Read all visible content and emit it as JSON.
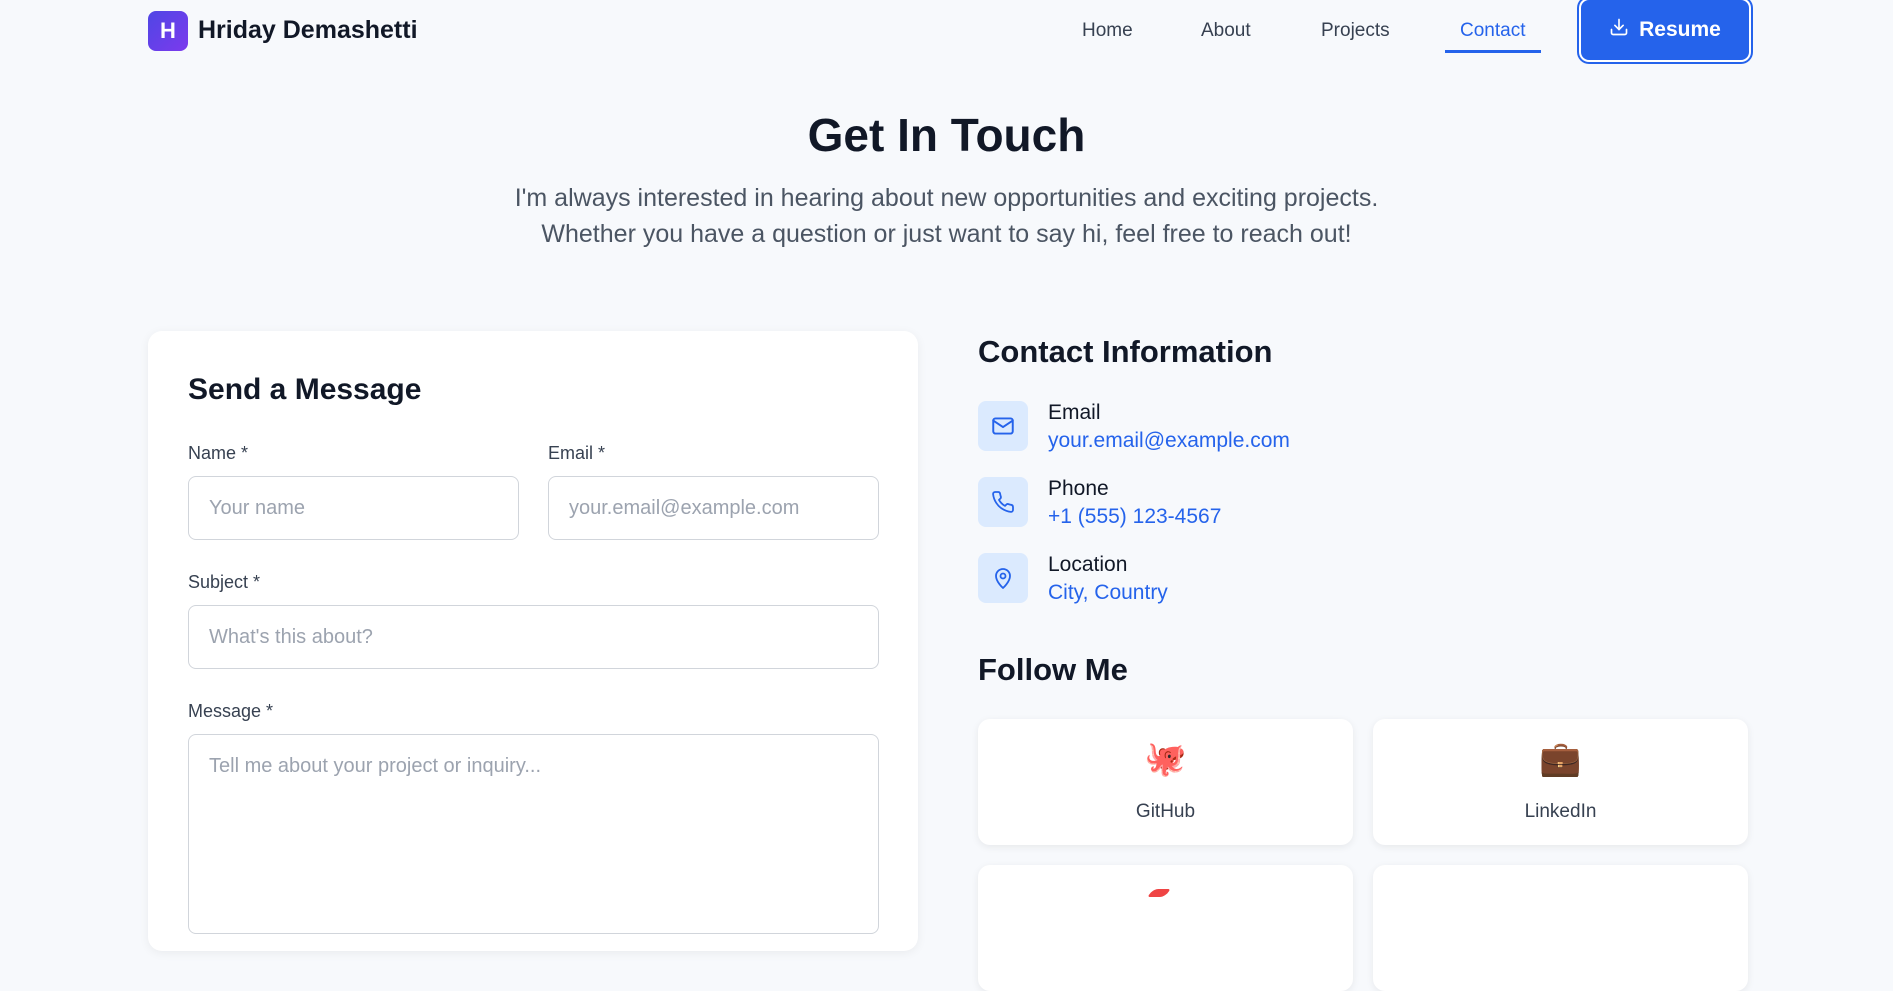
{
  "header": {
    "logo_letter": "H",
    "brand": "Hriday Demashetti",
    "nav": {
      "home": "Home",
      "about": "About",
      "projects": "Projects",
      "contact": "Contact"
    },
    "active_nav": "Contact",
    "resume_label": "Resume"
  },
  "hero": {
    "title": "Get In Touch",
    "subtitle_line1": "I'm always interested in hearing about new opportunities and exciting projects.",
    "subtitle_line2": "Whether you have a question or just want to say hi, feel free to reach out!"
  },
  "form": {
    "title": "Send a Message",
    "name_label": "Name *",
    "name_placeholder": "Your name",
    "email_label": "Email *",
    "email_placeholder": "your.email@example.com",
    "subject_label": "Subject *",
    "subject_placeholder": "What's this about?",
    "message_label": "Message *",
    "message_placeholder": "Tell me about your project or inquiry..."
  },
  "contact_info": {
    "title": "Contact Information",
    "items": [
      {
        "label": "Email",
        "value": "your.email@example.com",
        "icon": "mail-icon"
      },
      {
        "label": "Phone",
        "value": "+1 (555) 123-4567",
        "icon": "phone-icon"
      },
      {
        "label": "Location",
        "value": "City, Country",
        "icon": "map-pin-icon"
      }
    ]
  },
  "follow": {
    "title": "Follow Me",
    "items": [
      {
        "label": "GitHub",
        "emoji": "🐙",
        "icon": "octopus-icon"
      },
      {
        "label": "LinkedIn",
        "emoji": "💼",
        "icon": "briefcase-icon"
      }
    ]
  },
  "colors": {
    "accent": "#2563eb",
    "icon_bg": "#dbeafe",
    "page_bg": "#f7f9fc"
  }
}
